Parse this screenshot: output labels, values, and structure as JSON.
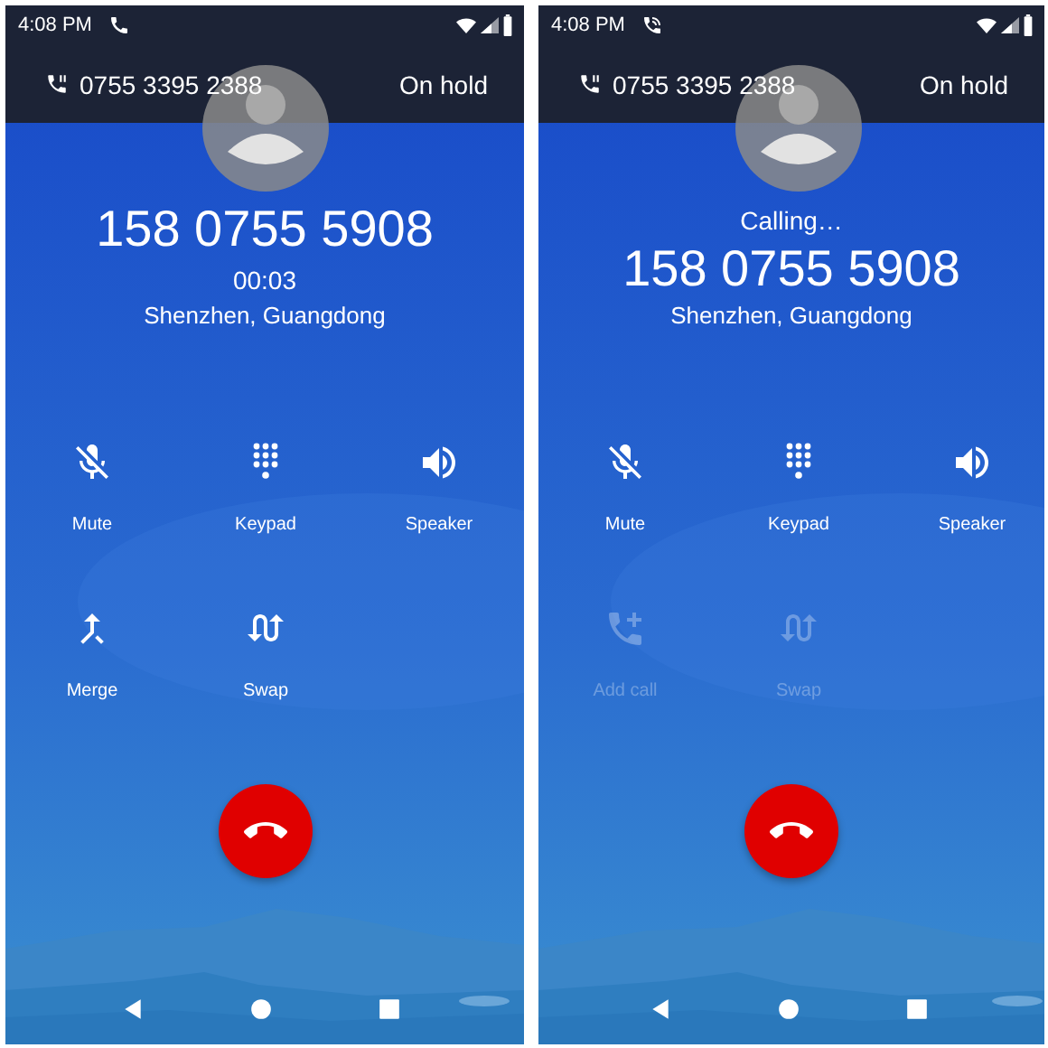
{
  "screens": [
    {
      "status_bar": {
        "time": "4:08 PM",
        "kind": "talk"
      },
      "hold_bar": {
        "number": "0755 3395 2388",
        "status": "On hold"
      },
      "lines": [
        {
          "kind": "number",
          "text": "158 0755 5908"
        },
        {
          "kind": "timer",
          "text": "00:03"
        },
        {
          "kind": "location",
          "text": "Shenzhen, Guangdong"
        }
      ],
      "buttons": [
        {
          "kind": "mute",
          "label": "Mute",
          "disabled": false
        },
        {
          "kind": "keypad",
          "label": "Keypad",
          "disabled": false
        },
        {
          "kind": "speaker",
          "label": "Speaker",
          "disabled": false
        },
        {
          "kind": "merge",
          "label": "Merge",
          "disabled": false
        },
        {
          "kind": "swap",
          "label": "Swap",
          "disabled": false
        }
      ]
    },
    {
      "status_bar": {
        "time": "4:08 PM",
        "kind": "ringing"
      },
      "hold_bar": {
        "number": "0755 3395 2388",
        "status": "On hold"
      },
      "lines": [
        {
          "kind": "status",
          "text": "Calling…"
        },
        {
          "kind": "number",
          "text": "158 0755 5908"
        },
        {
          "kind": "location",
          "text": "Shenzhen, Guangdong"
        }
      ],
      "buttons": [
        {
          "kind": "mute",
          "label": "Mute",
          "disabled": false
        },
        {
          "kind": "keypad",
          "label": "Keypad",
          "disabled": false
        },
        {
          "kind": "speaker",
          "label": "Speaker",
          "disabled": false
        },
        {
          "kind": "add_call",
          "label": "Add call",
          "disabled": true
        },
        {
          "kind": "swap",
          "label": "Swap",
          "disabled": true
        }
      ]
    }
  ]
}
